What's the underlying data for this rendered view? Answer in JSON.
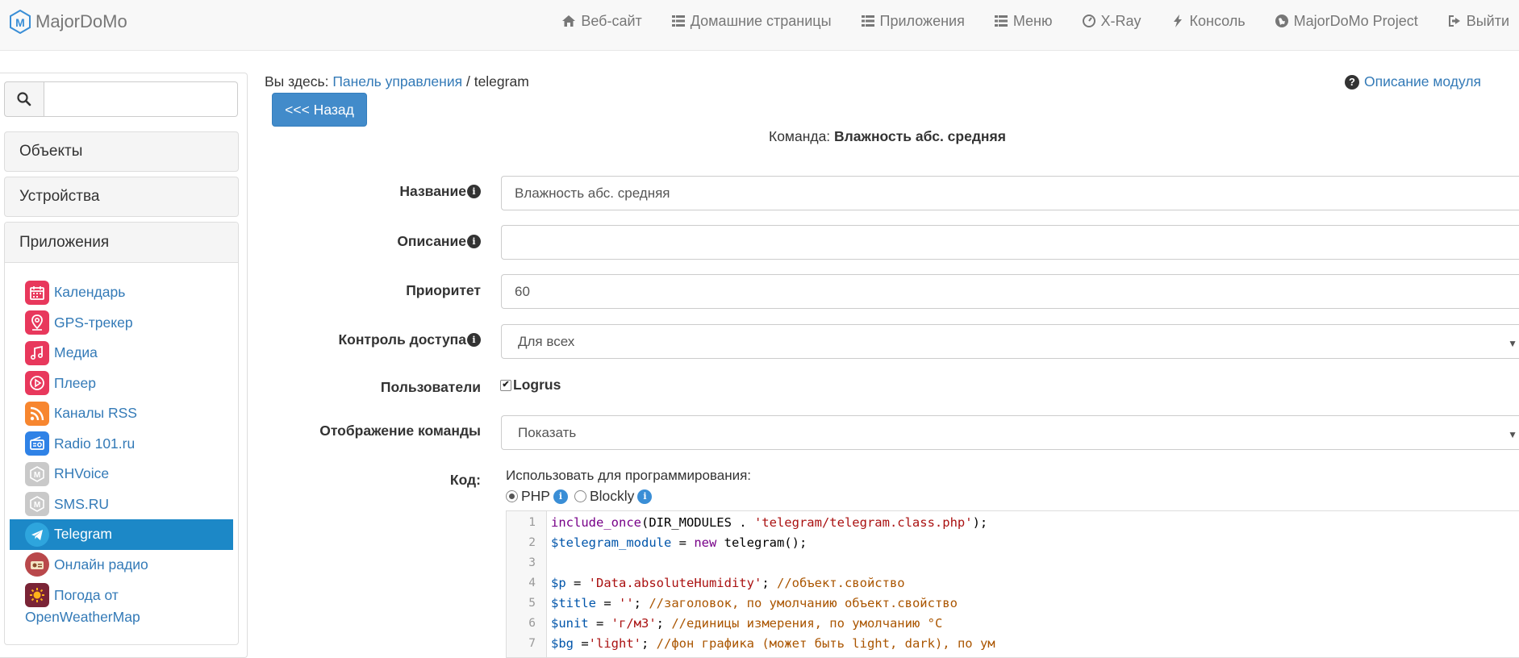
{
  "navbar": {
    "brand": "MajorDoMo",
    "items": [
      {
        "label": "Веб-сайт",
        "icon": "home-icon"
      },
      {
        "label": "Домашние страницы",
        "icon": "list-icon"
      },
      {
        "label": "Приложения",
        "icon": "list-icon"
      },
      {
        "label": "Меню",
        "icon": "list-icon"
      },
      {
        "label": "X-Ray",
        "icon": "dashboard-icon"
      },
      {
        "label": "Консоль",
        "icon": "bolt-icon"
      },
      {
        "label": "MajorDoMo Project",
        "icon": "globe-icon"
      },
      {
        "label": "Выйти",
        "icon": "logout-icon"
      }
    ]
  },
  "sidebar": {
    "search_placeholder": "",
    "sections": [
      "Объекты",
      "Устройства",
      "Приложения"
    ],
    "apps": [
      {
        "label": "Календарь",
        "icon": "calendar-icon",
        "color": "#e8385c"
      },
      {
        "label": "GPS-трекер",
        "icon": "location-icon",
        "color": "#e8385c"
      },
      {
        "label": "Медиа",
        "icon": "music-icon",
        "color": "#e8385c"
      },
      {
        "label": "Плеер",
        "icon": "play-icon",
        "color": "#e8385c"
      },
      {
        "label": "Каналы RSS",
        "icon": "rss-icon",
        "color": "#f7862f"
      },
      {
        "label": "Radio 101.ru",
        "icon": "radio-icon",
        "color": "#2f82e6"
      },
      {
        "label": "RHVoice",
        "icon": "majordomo-icon",
        "color": "#c9c9c9"
      },
      {
        "label": "SMS.RU",
        "icon": "majordomo-icon",
        "color": "#c9c9c9"
      },
      {
        "label": "Telegram",
        "icon": "telegram-icon",
        "color": "#2ea5dd"
      },
      {
        "label": "Онлайн радио",
        "icon": "radio-online-icon",
        "color": "#b9484b"
      },
      {
        "label": "Погода от",
        "label_cont": "OpenWeatherMap",
        "icon": "weather-icon",
        "color": "#7a2436"
      }
    ],
    "active_app": "Telegram"
  },
  "breadcrumb": {
    "prefix": "Вы здесь:",
    "link": "Панель управления",
    "separator": "/",
    "current": "telegram"
  },
  "module_desc": "Описание модуля",
  "back_button": "<<< Назад",
  "command_header": {
    "prefix": "Команда:",
    "name": "Влажность абс. средняя"
  },
  "form": {
    "title": {
      "label": "Название",
      "value": "Влажность абс. средняя"
    },
    "description": {
      "label": "Описание",
      "value": ""
    },
    "priority": {
      "label": "Приоритет",
      "value": "60"
    },
    "access": {
      "label": "Контроль доступа",
      "value": "Для всех"
    },
    "users": {
      "label": "Пользователи",
      "user": "Logrus",
      "checked": true
    },
    "display": {
      "label": "Отображение команды",
      "value": "Показать"
    },
    "code": {
      "label": "Код:",
      "use_for": "Использовать для программирования:",
      "options": [
        "PHP",
        "Blockly"
      ],
      "selected": "PHP",
      "lines": [
        {
          "n": "1"
        },
        {
          "n": "2"
        },
        {
          "n": "3"
        },
        {
          "n": "4"
        },
        {
          "n": "5"
        },
        {
          "n": "6"
        },
        {
          "n": "7"
        }
      ],
      "tokens": {
        "l1a": "include_once",
        "l1b": "(DIR_MODULES . ",
        "l1c": "'telegram/telegram.class.php'",
        "l1d": ");",
        "l2a": "$telegram_module",
        "l2b": " = ",
        "l2c": "new",
        "l2d": " telegram();",
        "l4a": "$p",
        "l4b": " = ",
        "l4c": "'Data.absoluteHumidity'",
        "l4d": "; ",
        "l4e": "//объект.свойство",
        "l5a": "$title",
        "l5b": " = ",
        "l5c": "''",
        "l5d": "; ",
        "l5e": "//заголовок, по умолчанию объект.свойство",
        "l6a": "$unit",
        "l6b": " = ",
        "l6c": "'г/м3'",
        "l6d": "; ",
        "l6e": "//единицы измерения, по умолчанию °C",
        "l7a": "$bg",
        "l7b": " =",
        "l7c": "'light'",
        "l7d": "; ",
        "l7e": "//фон графика (может быть light, dark), по ум"
      }
    }
  }
}
